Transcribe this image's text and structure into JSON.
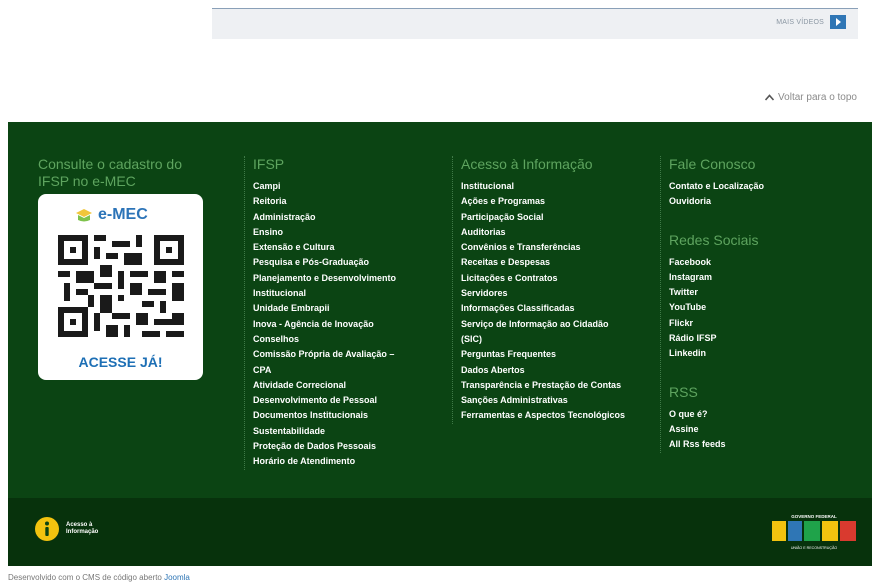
{
  "videos": {
    "more_label": "MAIS VÍDEOS"
  },
  "back_to_top": "Voltar para o topo",
  "footer": {
    "emec": {
      "title": "Consulte o cadastro do IFSP no e-MEC",
      "logo_text": "e-MEC",
      "cta": "ACESSE JÁ!"
    },
    "ifsp": {
      "title": "IFSP",
      "items": [
        "Campi",
        "Reitoria",
        "Administração",
        "Ensino",
        "Extensão e Cultura",
        "Pesquisa e Pós-Graduação",
        "Planejamento e Desenvolvimento Institucional",
        "Unidade Embrapii",
        "Inova - Agência de Inovação",
        "Conselhos",
        "Comissão Própria de Avaliação – CPA",
        "Atividade Correcional",
        "Desenvolvimento de Pessoal",
        "Documentos Institucionais",
        "Sustentabilidade",
        "Proteção de Dados Pessoais",
        "Horário de Atendimento"
      ]
    },
    "acesso": {
      "title": "Acesso à Informação",
      "items": [
        "Institucional",
        "Ações e Programas",
        "Participação Social",
        "Auditorias",
        "Convênios e Transferências",
        "Receitas e Despesas",
        "Licitações e Contratos",
        "Servidores",
        "Informações Classificadas",
        "Serviço de Informação ao Cidadão (SIC)",
        "Perguntas Frequentes",
        "Dados Abertos",
        "Transparência e Prestação de Contas",
        "Sanções Administrativas",
        "Ferramentas e Aspectos Tecnológicos"
      ]
    },
    "fale": {
      "title": "Fale Conosco",
      "items": [
        "Contato e Localização",
        "Ouvidoria"
      ]
    },
    "redes": {
      "title": "Redes Sociais",
      "items": [
        "Facebook",
        "Instagram",
        "Twitter",
        "YouTube",
        "Flickr",
        "Rádio IFSP",
        "Linkedin"
      ]
    },
    "rss": {
      "title": "RSS",
      "items": [
        "O que é?",
        "Assine",
        "All Rss feeds"
      ]
    }
  },
  "bottom": {
    "acesso_label_1": "Acesso à",
    "acesso_label_2": "Informação",
    "gov_top": "GOVERNO FEDERAL",
    "gov_bottom": "UNIÃO E RECONSTRUÇÃO"
  },
  "credit": {
    "text": "Desenvolvido com o CMS de código aberto",
    "link": "Joomla"
  },
  "colors": {
    "footer_green": "#0b4413",
    "heading_green": "#5ea45f",
    "link_blue": "#2f76b5"
  }
}
